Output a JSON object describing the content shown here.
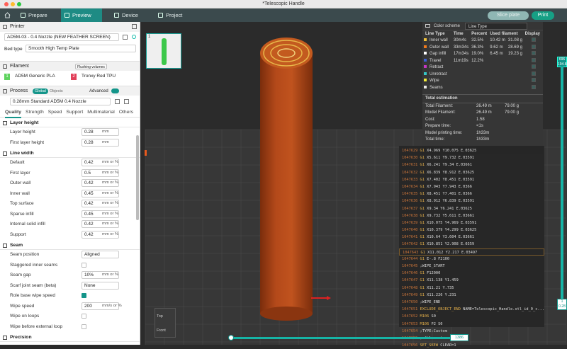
{
  "window": {
    "title": "*Telescopic Handle"
  },
  "toolbar": {
    "tabs": [
      {
        "label": "Prepare"
      },
      {
        "label": "Preview"
      },
      {
        "label": "Device"
      },
      {
        "label": "Project"
      }
    ],
    "slice_label": "Slice plate",
    "print_label": "Print"
  },
  "printer": {
    "section": "Printer",
    "name": "AD5M-03 - 0.4 Nozzle (NEW FEATHER SCREEN)",
    "bed_type_label": "Bed type",
    "bed_type": "Smooth High Temp Plate"
  },
  "filament": {
    "section": "Filament",
    "flushing": "Flushing volumes",
    "slots": [
      {
        "index": "1",
        "name": "AD5M Generic PLA",
        "color": "#5fd35f"
      },
      {
        "index": "2",
        "name": "Tronxy Red TPU",
        "color": "#e2405a"
      }
    ]
  },
  "process": {
    "section": "Process",
    "toggle": [
      "Global",
      "Objects"
    ],
    "advanced": "Advanced",
    "preset": "0.28mm Standard AD5M 0.4 Nozzle",
    "tabs": [
      "Quality",
      "Strength",
      "Speed",
      "Support",
      "Multimaterial",
      "Others"
    ],
    "groups": [
      {
        "title": "Layer height",
        "params": [
          {
            "label": "Layer height",
            "value": "0.28",
            "unit": "mm"
          },
          {
            "label": "First layer height",
            "value": "0.28",
            "unit": "mm"
          }
        ]
      },
      {
        "title": "Line width",
        "params": [
          {
            "label": "Default",
            "value": "0.42",
            "unit": "mm or %"
          },
          {
            "label": "First layer",
            "value": "0.5",
            "unit": "mm or %"
          },
          {
            "label": "Outer wall",
            "value": "0.42",
            "unit": "mm or %"
          },
          {
            "label": "Inner wall",
            "value": "0.45",
            "unit": "mm or %"
          },
          {
            "label": "Top surface",
            "value": "0.42",
            "unit": "mm or %"
          },
          {
            "label": "Sparse infill",
            "value": "0.45",
            "unit": "mm or %"
          },
          {
            "label": "Internal solid infill",
            "value": "0.42",
            "unit": "mm or %"
          },
          {
            "label": "Support",
            "value": "0.42",
            "unit": "mm or %"
          }
        ]
      },
      {
        "title": "Seam",
        "params": [
          {
            "label": "Seam position",
            "value": "Aligned",
            "unit": ""
          },
          {
            "label": "Staggered inner seams",
            "check": false
          },
          {
            "label": "Seam gap",
            "value": "10%",
            "unit": "mm or %"
          },
          {
            "label": "Scarf joint seam (beta)",
            "value": "None",
            "unit": ""
          },
          {
            "label": "Role base wipe speed",
            "check": true
          },
          {
            "label": "Wipe speed",
            "value": "200",
            "unit": "mm/s or %"
          },
          {
            "label": "Wipe on loops",
            "check": false
          },
          {
            "label": "Wipe before external loop",
            "check": false
          }
        ]
      },
      {
        "title": "Precision",
        "params": []
      }
    ]
  },
  "thumbnail": {
    "index": "1"
  },
  "legend": {
    "scheme_label": "Color scheme",
    "scheme": "Line Type",
    "headers": [
      "Line Type",
      "Time",
      "Percent",
      "Used filament",
      "Display"
    ],
    "rows": [
      {
        "name": "Inner wall",
        "color": "#f0c23a",
        "time": "30m4s",
        "percent": "32.5%",
        "len": "10.42 m",
        "weight": "31.08 g"
      },
      {
        "name": "Outer wall",
        "color": "#f07a1c",
        "time": "33m34s",
        "percent": "36.3%",
        "len": "9.62 m",
        "weight": "28.69 g"
      },
      {
        "name": "Gap infill",
        "color": "#ffffff",
        "time": "17m34s",
        "percent": "19.0%",
        "len": "6.45 m",
        "weight": "19.23 g"
      },
      {
        "name": "Travel",
        "color": "#3b5fd6",
        "time": "11m19s",
        "percent": "12.2%",
        "len": "",
        "weight": ""
      },
      {
        "name": "Retract",
        "color": "#c437c4",
        "time": "",
        "percent": "",
        "len": "",
        "weight": ""
      },
      {
        "name": "Unretract",
        "color": "#36c6c6",
        "time": "",
        "percent": "",
        "len": "",
        "weight": ""
      },
      {
        "name": "Wipe",
        "color": "#f2ec3a",
        "time": "",
        "percent": "",
        "len": "",
        "weight": ""
      },
      {
        "name": "Seams",
        "color": "#e8e8e8",
        "time": "",
        "percent": "",
        "len": "",
        "weight": ""
      }
    ],
    "total_title": "Total estimation",
    "totals": [
      {
        "k": "Total Filament:",
        "a": "26.49 m",
        "b": "79.00 g"
      },
      {
        "k": "Model Filament:",
        "a": "26.49 m",
        "b": "79.00 g"
      },
      {
        "k": "Cost:",
        "a": "1.58",
        "b": ""
      },
      {
        "k": "Prepare time:",
        "a": "<1s",
        "b": ""
      },
      {
        "k": "Model printing time:",
        "a": "1h33m",
        "b": ""
      },
      {
        "k": "Total time:",
        "a": "1h33m",
        "b": ""
      }
    ]
  },
  "gcode": [
    {
      "n": "1047629",
      "c": "G1",
      "t": "X4.969 Y10.075 E.03625"
    },
    {
      "n": "1047630",
      "c": "G1",
      "t": "X5.611 Y9.732 E.03591"
    },
    {
      "n": "1047631",
      "c": "G1",
      "t": "X6.241 Y9.34 E.03661"
    },
    {
      "n": "1047632",
      "c": "G1",
      "t": "X6.839 Y8.912 E.03625"
    },
    {
      "n": "1047633",
      "c": "G1",
      "t": "X7.402 Y8.451 E.03591"
    },
    {
      "n": "1047634",
      "c": "G1",
      "t": "X7.943 Y7.943 E.0366"
    },
    {
      "n": "1047635",
      "c": "G1",
      "t": "X8.451 Y7.401 E.0366"
    },
    {
      "n": "1047636",
      "c": "G1",
      "t": "X8.912 Y6.839 E.03591"
    },
    {
      "n": "1047637",
      "c": "G1",
      "t": "X9.34 Y6.241 E.03625"
    },
    {
      "n": "1047638",
      "c": "G1",
      "t": "X9.732 Y5.611 E.03661"
    },
    {
      "n": "1047639",
      "c": "G1",
      "t": "X10.075 Y4.969 E.03591"
    },
    {
      "n": "1047640",
      "c": "G1",
      "t": "X10.379 Y4.299 E.03625"
    },
    {
      "n": "1047641",
      "c": "G1",
      "t": "X10.64 Y3.604 E.03661"
    },
    {
      "n": "1047642",
      "c": "G1",
      "t": "X10.851 Y2.908 E.0359"
    },
    {
      "n": "1047643",
      "c": "G1",
      "t": "X11.012 Y2.217 E.03497"
    },
    {
      "n": "1047644",
      "c": "G1",
      "t": "E-.8 F2100"
    },
    {
      "n": "1047645",
      "c": "",
      "t": ";WIPE_START"
    },
    {
      "n": "1047646",
      "c": "G1",
      "t": "F12000"
    },
    {
      "n": "1047647",
      "c": "G1",
      "t": "X11.138 Y1.459"
    },
    {
      "n": "1047648",
      "c": "G1",
      "t": "X11.21 Y.735"
    },
    {
      "n": "1047649",
      "c": "G1",
      "t": "X11.226 Y.231"
    },
    {
      "n": "1047650",
      "c": "",
      "t": ";WIPE_END"
    },
    {
      "n": "1047651",
      "c": "EXCLUDE_OBJECT_END",
      "t": "NAME=Telescopic_Handle.stl_id_0_c..."
    },
    {
      "n": "1047652",
      "c": "M106",
      "t": "S0"
    },
    {
      "n": "1047653",
      "c": "M106",
      "t": "P2 S0"
    },
    {
      "n": "1047654",
      "c": "",
      "t": ";TYPE:Custom"
    },
    {
      "n": "1047655",
      "c": "",
      "t": "; filament end gcode"
    },
    {
      "n": "1047656",
      "c": "SET_SKEW",
      "t": "CLEAR=1"
    }
  ],
  "vslider": {
    "top_layer": "696",
    "top_z": "194.88",
    "bottom_layer": "1",
    "bottom_z": "0.28"
  },
  "hslider": {
    "value": "1386"
  },
  "navcube": {
    "top": "Top",
    "front": "Front"
  }
}
